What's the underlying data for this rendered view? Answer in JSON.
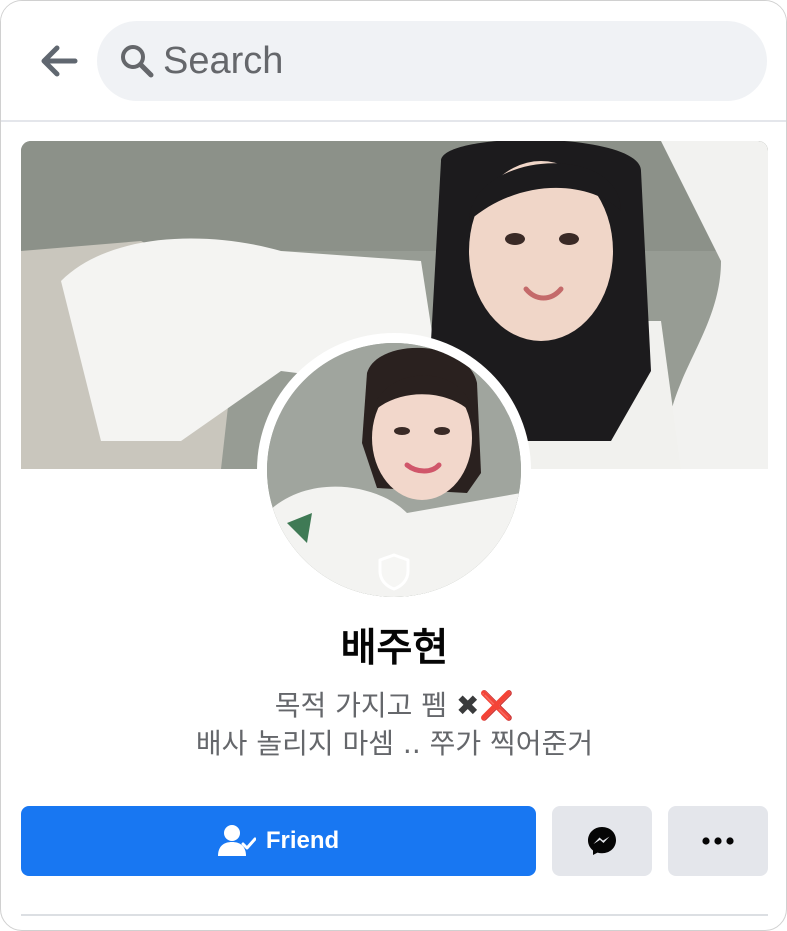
{
  "search": {
    "placeholder": "Search"
  },
  "profile": {
    "name": "배주현",
    "bio_line1_text": "목적 가지고 펨 ",
    "bio_line1_emoji1": "✖",
    "bio_line1_emoji2": "❌",
    "bio_line2": "배사 놀리지 마셈 .. 쭈가 찍어준거"
  },
  "actions": {
    "friend_label": "Friend"
  },
  "icons": {
    "back": "arrow-left-icon",
    "search": "search-icon",
    "shield": "profile-guard-shield-icon",
    "friend": "friend-check-icon",
    "messenger": "messenger-icon",
    "more": "more-dots-icon"
  },
  "colors": {
    "primary": "#1877f2",
    "search_bg": "#f0f2f5",
    "secondary_button_bg": "#e4e6eb",
    "secondary_text": "#65676b",
    "text": "#050505"
  }
}
